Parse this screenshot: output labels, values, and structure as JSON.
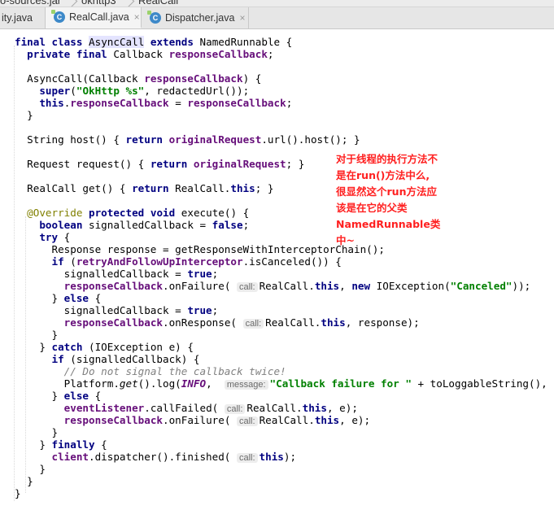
{
  "breadcrumb": {
    "items": [
      "o-sources.jar",
      "okhttp3",
      "RealCall"
    ]
  },
  "tabs": [
    {
      "label": "ity.java",
      "icon": "none",
      "active": false
    },
    {
      "label": "RealCall.java",
      "icon": "class-icon",
      "active": true
    },
    {
      "label": "Dispatcher.java",
      "icon": "class-icon",
      "active": false
    }
  ],
  "icons": {
    "class_letter": "C",
    "close": "×"
  },
  "code_lines": [
    "final class AsyncCall extends NamedRunnable {",
    "  private final Callback responseCallback;",
    "",
    "  AsyncCall(Callback responseCallback) {",
    "    super(\"OkHttp %s\", redactedUrl());",
    "    this.responseCallback = responseCallback;",
    "  }",
    "",
    "  String host() { return originalRequest.url().host(); }",
    "",
    "  Request request() { return originalRequest; }",
    "",
    "  RealCall get() { return RealCall.this; }",
    "",
    "  @Override protected void execute() {",
    "    boolean signalledCallback = false;",
    "    try {",
    "      Response response = getResponseWithInterceptorChain();",
    "      if (retryAndFollowUpInterceptor.isCanceled()) {",
    "        signalledCallback = true;",
    "        responseCallback.onFailure( call: RealCall.this, new IOException(\"Canceled\"));",
    "      } else {",
    "        signalledCallback = true;",
    "        responseCallback.onResponse( call: RealCall.this, response);",
    "      }",
    "    } catch (IOException e) {",
    "      if (signalledCallback) {",
    "        // Do not signal the callback twice!",
    "        Platform.get().log(INFO,  message: \"Callback failure for \" + toLoggableString(), e);",
    "      } else {",
    "        eventListener.callFailed( call: RealCall.this, e);",
    "        responseCallback.onFailure( call: RealCall.this, e);",
    "      }",
    "    } finally {",
    "      client.dispatcher().finished( call: this);",
    "    }",
    "  }",
    "}"
  ],
  "annotation": {
    "color": "#ff2020",
    "lines": [
      "对于线程的执行方法不",
      "是在run()方法中么,",
      "很显然这个run方法应",
      "该是在它的父类",
      "NamedRunnable类",
      "中~"
    ]
  },
  "colors": {
    "keyword": "#000080",
    "field": "#660e7a",
    "string": "#008000",
    "comment": "#808080",
    "annotation_attr": "#808000",
    "tab_icon": "#3d89c9"
  }
}
